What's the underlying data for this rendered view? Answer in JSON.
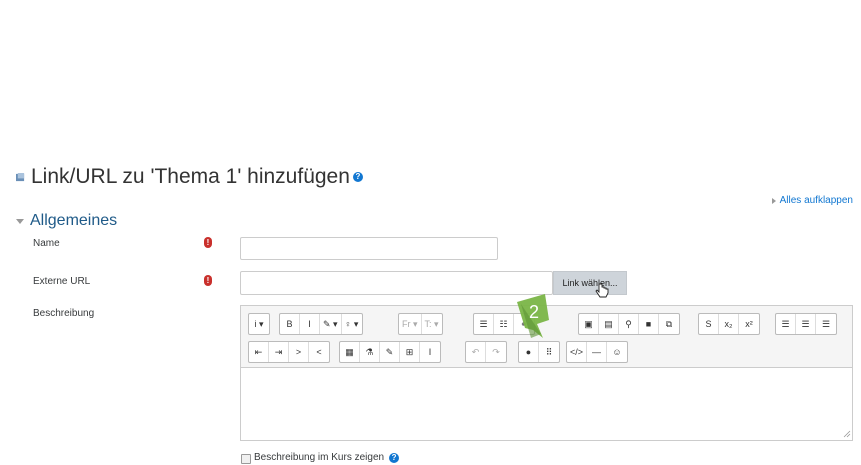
{
  "page": {
    "title": "Link/URL zu 'Thema 1' hinzufügen",
    "expand_all": "Alles aufklappen"
  },
  "section": {
    "title": "Allgemeines"
  },
  "fields": {
    "name": {
      "label": "Name",
      "value": ""
    },
    "url": {
      "label": "Externe URL",
      "value": "",
      "button": "Link wählen..."
    },
    "description": {
      "label": "Beschreibung",
      "value": ""
    },
    "show_description": {
      "label": "Beschreibung im Kurs zeigen",
      "checked": false
    }
  },
  "toolbar": {
    "row1": [
      {
        "name": "paragraph-styles-icon",
        "text": "i ▾"
      },
      {
        "name": "bold-icon",
        "text": "B"
      },
      {
        "name": "italic-icon",
        "text": "I"
      },
      {
        "name": "font-color-icon",
        "text": "✎ ▾"
      },
      {
        "name": "highlight-icon",
        "text": "♀ ▾"
      },
      {
        "name": "font-family-icon",
        "text": "Fr ▾"
      },
      {
        "name": "font-size-icon",
        "text": "T: ▾"
      },
      {
        "name": "unordered-list-icon",
        "text": "☰"
      },
      {
        "name": "ordered-list-icon",
        "text": "☷"
      },
      {
        "name": "link-icon",
        "text": "⚭"
      },
      {
        "name": "image-icon",
        "text": "▣"
      },
      {
        "name": "media-icon",
        "text": "▤"
      },
      {
        "name": "record-audio-icon",
        "text": "⚲"
      },
      {
        "name": "record-video-icon",
        "text": "■"
      },
      {
        "name": "manage-files-icon",
        "text": "⧉"
      },
      {
        "name": "strikethrough-icon",
        "text": "S"
      },
      {
        "name": "subscript-icon",
        "text": "x₂"
      },
      {
        "name": "superscript-icon",
        "text": "x²"
      },
      {
        "name": "align-left-icon",
        "text": "☰"
      },
      {
        "name": "align-center-icon",
        "text": "☰"
      },
      {
        "name": "align-right-icon",
        "text": "☰"
      }
    ],
    "row2": [
      {
        "name": "outdent-icon",
        "text": "⇤"
      },
      {
        "name": "indent-icon",
        "text": "⇥"
      },
      {
        "name": "ltr-icon",
        "text": ">"
      },
      {
        "name": "rtl-icon",
        "text": "<"
      },
      {
        "name": "equation-icon",
        "text": "▦"
      },
      {
        "name": "chemistry-icon",
        "text": "⚗"
      },
      {
        "name": "edit-icon",
        "text": "✎"
      },
      {
        "name": "table-icon",
        "text": "⊞"
      },
      {
        "name": "clear-format-icon",
        "text": "I"
      },
      {
        "name": "undo-icon",
        "text": "↶"
      },
      {
        "name": "redo-icon",
        "text": "↷"
      },
      {
        "name": "accessibility-icon",
        "text": "●"
      },
      {
        "name": "screenreader-icon",
        "text": "⠿"
      },
      {
        "name": "html-icon",
        "text": "</>"
      },
      {
        "name": "hr-icon",
        "text": "—"
      },
      {
        "name": "emoticon-icon",
        "text": "☺"
      }
    ]
  },
  "marker": {
    "label": "2"
  },
  "colors": {
    "accent": "#1177d1",
    "required": "#c9302c",
    "marker": "#7ab547"
  }
}
